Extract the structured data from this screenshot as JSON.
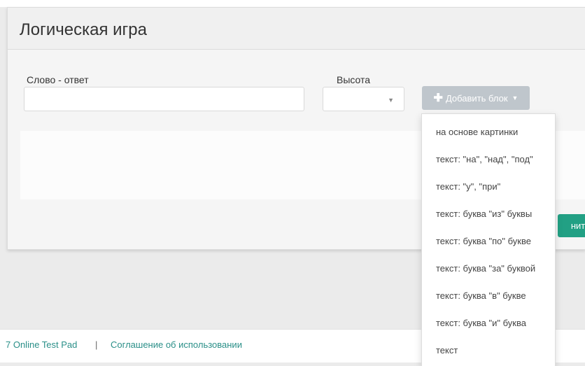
{
  "header": {
    "title": "Логическая игра"
  },
  "form": {
    "answer_label": "Слово - ответ",
    "answer_value": "",
    "height_label": "Высота",
    "height_value": "",
    "add_block_label": "Добавить блок"
  },
  "actions": {
    "save_label_partial": "нить"
  },
  "dropdown": {
    "items": [
      "на основе картинки",
      "текст: \"на\", \"над\", \"под\"",
      "текст: \"у\", \"при\"",
      "текст: буква \"из\" буквы",
      "текст: буква \"по\" букве",
      "текст: буква \"за\" буквой",
      "текст: буква \"в\" букве",
      "текст: буква \"и\" буква",
      "текст"
    ]
  },
  "footer": {
    "brand_link": "7 Online Test Pad",
    "separator": "|",
    "agreement_link": "Соглашение об использовании"
  },
  "colors": {
    "accent": "#22a084",
    "link": "#2a8f88",
    "add_button": "#bfc6cc"
  }
}
